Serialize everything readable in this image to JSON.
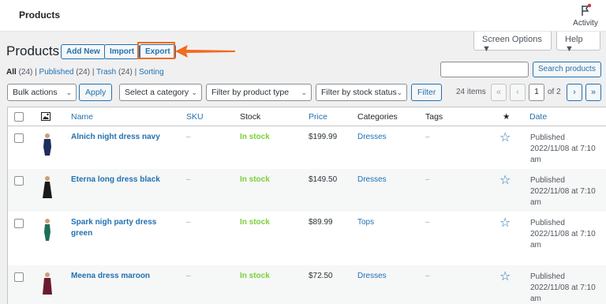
{
  "topbar": {
    "title": "Products",
    "activity_label": "Activity"
  },
  "screen_options": "Screen Options ▼",
  "help": "Help ▼",
  "header": {
    "title": "Products",
    "add_new": "Add New",
    "import": "Import",
    "export": "Export"
  },
  "status_links": {
    "all": "All",
    "all_count": "(24)",
    "published": "Published",
    "published_count": "(24)",
    "trash": "Trash",
    "trash_count": "(24)",
    "sorting": "Sorting"
  },
  "search": {
    "placeholder": "",
    "button": "Search products"
  },
  "filters": {
    "bulk_actions": "Bulk actions",
    "apply": "Apply",
    "category": "Select a category",
    "product_type": "Filter by product type",
    "stock_status": "Filter by stock status",
    "filter": "Filter"
  },
  "pagination": {
    "items": "24 items",
    "first": "«",
    "prev": "‹",
    "current": "1",
    "of": "of 2",
    "next": "›",
    "last": "»"
  },
  "columns": {
    "name": "Name",
    "sku": "SKU",
    "stock": "Stock",
    "price": "Price",
    "categories": "Categories",
    "tags": "Tags",
    "featured": "★",
    "date": "Date"
  },
  "products": [
    {
      "name": "Alnich night dress navy",
      "name2": "",
      "sku": "–",
      "stock": "In stock",
      "price": "$199.99",
      "category": "Dresses",
      "tags": "–",
      "date1": "Published",
      "date2": "2022/11/08 at 7:10",
      "date3": "am",
      "thumb_color": "#1f2d5c"
    },
    {
      "name": "Eterna long dress black",
      "name2": "",
      "sku": "–",
      "stock": "In stock",
      "price": "$149.50",
      "category": "Dresses",
      "tags": "–",
      "date1": "Published",
      "date2": "2022/11/08 at 7:10",
      "date3": "am",
      "thumb_color": "#1a1a1a"
    },
    {
      "name": "Spark nigh party dress",
      "name2": "green",
      "sku": "–",
      "stock": "In stock",
      "price": "$89.99",
      "category": "Tops",
      "tags": "–",
      "date1": "Published",
      "date2": "2022/11/08 at 7:10",
      "date3": "am",
      "thumb_color": "#1f6e5a"
    },
    {
      "name": "Meena dress maroon",
      "name2": "",
      "sku": "–",
      "stock": "In stock",
      "price": "$72.50",
      "category": "Dresses",
      "tags": "–",
      "date1": "Published",
      "date2": "2022/11/08 at 7:10",
      "date3": "am",
      "thumb_color": "#6b1a2e"
    }
  ],
  "colors": {
    "link": "#2271b1",
    "in_stock": "#7ad03a",
    "highlight": "#f16b1f"
  }
}
